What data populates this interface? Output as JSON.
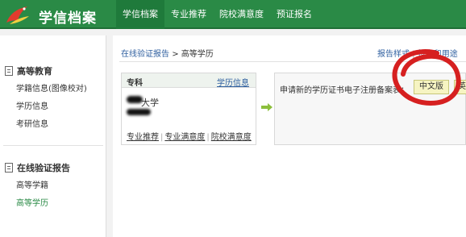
{
  "header": {
    "logo_text": "学信档案",
    "nav": [
      {
        "label": "学信档案",
        "active": true
      },
      {
        "label": "专业推荐",
        "active": false
      },
      {
        "label": "院校满意度",
        "active": false
      },
      {
        "label": "预证报名",
        "active": false
      }
    ]
  },
  "sidebar": {
    "section1": {
      "title": "高等教育",
      "items": [
        "学籍信息(图像校对)",
        "学历信息",
        "考研信息"
      ]
    },
    "section2": {
      "title": "在线验证报告",
      "items": [
        "高等学籍",
        "高等学历"
      ],
      "active_item": "高等学历"
    }
  },
  "main": {
    "breadcrumb": {
      "parent": "在线验证报告",
      "separator": ">",
      "current": "高等学历"
    },
    "top_links": [
      "报告样式",
      "特点和用途"
    ],
    "card": {
      "type": "专科",
      "info_link": "学历信息",
      "school_suffix": "大学",
      "links": [
        "专业推荐",
        "专业满意度",
        "院校满意度"
      ]
    },
    "apply": {
      "text": "申请新的学历证书电子注册备案表：",
      "btn_cn": "中文版",
      "btn_en": "英"
    }
  },
  "colors": {
    "brand_green": "#2a8a46",
    "link_blue": "#3060a0",
    "annotation_red": "#d62020"
  }
}
